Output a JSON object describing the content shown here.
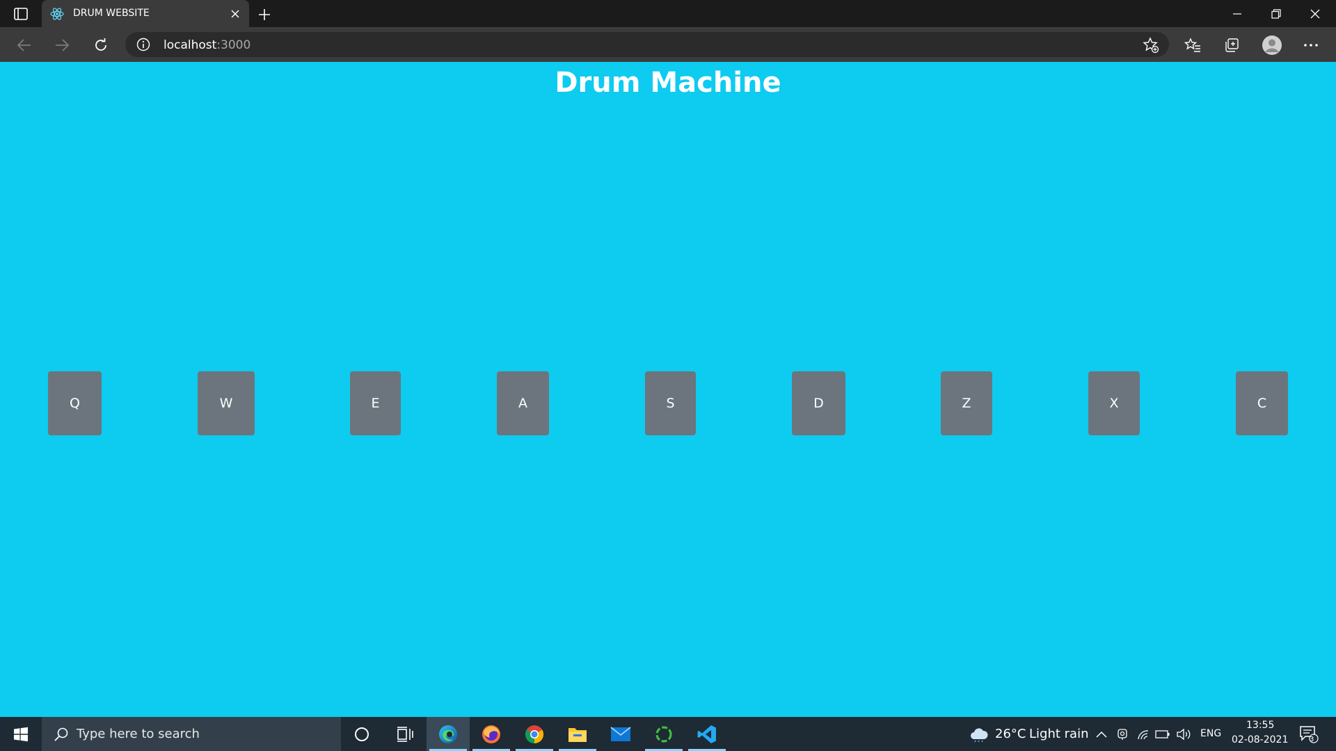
{
  "browser": {
    "tab_title": "DRUM WEBSITE",
    "url_host": "localhost",
    "url_port": ":3000"
  },
  "page": {
    "title": "Drum Machine",
    "pads": [
      "Q",
      "W",
      "E",
      "A",
      "S",
      "D",
      "Z",
      "X",
      "C"
    ]
  },
  "taskbar": {
    "search_placeholder": "Type here to search",
    "weather_temp": "26°C",
    "weather_desc": "Light rain",
    "language": "ENG",
    "time": "13:55",
    "date": "02-08-2021",
    "notification_count": "3"
  },
  "colors": {
    "page_bg": "#0ecbf0",
    "pad_bg": "#6c757d",
    "title": "#ffffff"
  }
}
